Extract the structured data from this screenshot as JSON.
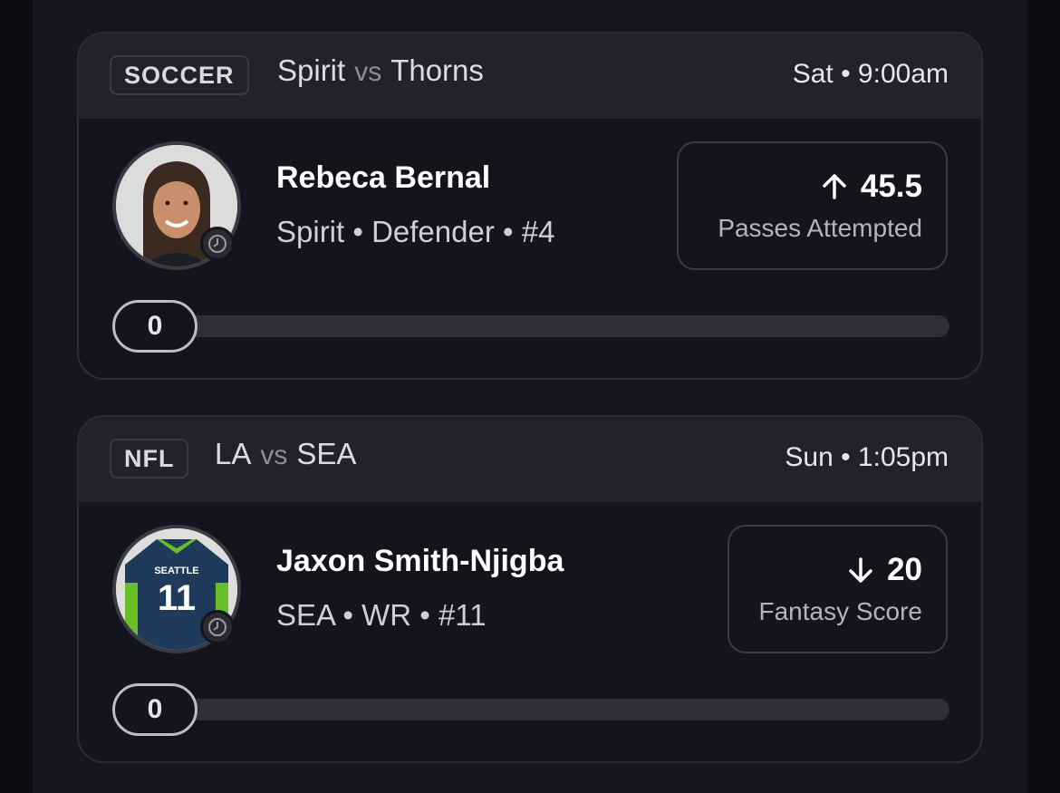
{
  "picks": [
    {
      "league": "SOCCER",
      "team1": "Spirit",
      "vs": "vs",
      "team2": "Thorns",
      "time": "Sat • 9:00am",
      "player_name": "Rebeca Bernal",
      "player_info": "Spirit • Defender • #4",
      "direction": "up",
      "value": "45.5",
      "stat": "Passes Attempted",
      "progress": "0"
    },
    {
      "league": "NFL",
      "team1": "LA",
      "vs": "vs",
      "team2": "SEA",
      "time": "Sun • 1:05pm",
      "player_name": "Jaxon Smith-Njigba",
      "player_info": "SEA • WR • #11",
      "direction": "down",
      "value": "20",
      "stat": "Fantasy Score",
      "progress": "0",
      "jersey_text": "SEATTLE",
      "jersey_number": "11"
    }
  ],
  "colors": {
    "background": "#0d0d13",
    "card": "#14141c",
    "card_header": "#22222b",
    "jersey_navy": "#1f3a5a",
    "jersey_green": "#69be28"
  }
}
